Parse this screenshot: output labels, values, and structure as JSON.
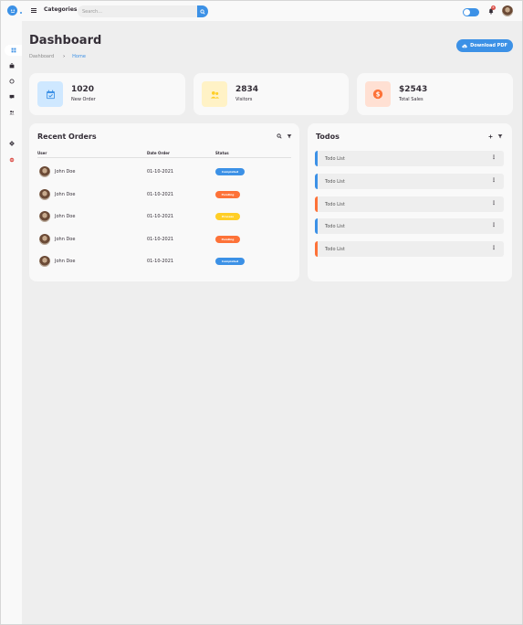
{
  "nav": {
    "categories_label": "Categories",
    "search_placeholder": "Search...",
    "notification_count": "8"
  },
  "page": {
    "title": "Dashboard",
    "breadcrumb": [
      "Dashboard",
      "Home"
    ],
    "download_label": "Download PDF"
  },
  "stats": [
    {
      "value": "1020",
      "label": "New Order",
      "icon": "calendar-check-icon",
      "color": "#3c91e6",
      "bg": "#cfe8ff"
    },
    {
      "value": "2834",
      "label": "Visitors",
      "icon": "group-icon",
      "color": "#ffce26",
      "bg": "#fff2c6"
    },
    {
      "value": "$2543",
      "label": "Total Sales",
      "icon": "dollar-circle-icon",
      "color": "#fd7238",
      "bg": "#ffe0d3"
    }
  ],
  "orders": {
    "title": "Recent Orders",
    "columns": [
      "User",
      "Date Order",
      "Status"
    ],
    "rows": [
      {
        "user": "John Doe",
        "date": "01-10-2021",
        "status": "Completed",
        "status_color": "#3c91e6"
      },
      {
        "user": "John Doe",
        "date": "01-10-2021",
        "status": "Pending",
        "status_color": "#fd7238"
      },
      {
        "user": "John Doe",
        "date": "01-10-2021",
        "status": "Process",
        "status_color": "#ffce26"
      },
      {
        "user": "John Doe",
        "date": "01-10-2021",
        "status": "Pending",
        "status_color": "#fd7238"
      },
      {
        "user": "John Doe",
        "date": "01-10-2021",
        "status": "Completed",
        "status_color": "#3c91e6"
      }
    ]
  },
  "todos": {
    "title": "Todos",
    "items": [
      {
        "text": "Todo List",
        "state": "completed"
      },
      {
        "text": "Todo List",
        "state": "completed"
      },
      {
        "text": "Todo List",
        "state": "not-completed"
      },
      {
        "text": "Todo List",
        "state": "completed"
      },
      {
        "text": "Todo List",
        "state": "not-completed"
      }
    ]
  },
  "sidebar": {
    "items": [
      "dashboard-icon",
      "shopping-bag-icon",
      "analytics-icon",
      "message-icon",
      "group-icon",
      "settings-icon",
      "logout-icon"
    ]
  },
  "colors": {
    "accent": "#3c91e6",
    "orange": "#fd7238",
    "yellow": "#ffce26",
    "red": "#db504a"
  }
}
